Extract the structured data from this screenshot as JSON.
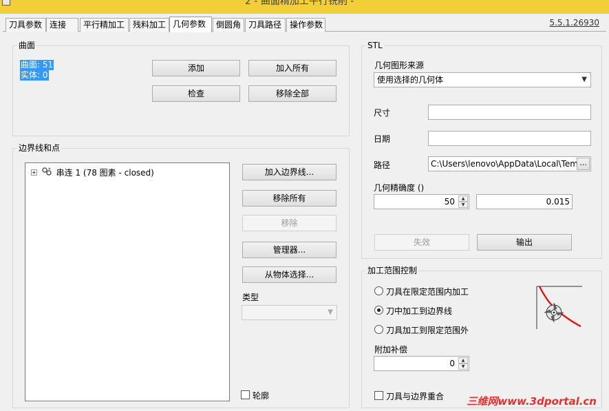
{
  "window": {
    "title": "2 - 曲面精加工平行铣削 -"
  },
  "tabs": [
    {
      "label": "刀具参数"
    },
    {
      "label": "连接"
    },
    {
      "label": "平行精加工"
    },
    {
      "label": "残料加工"
    },
    {
      "label": "几何参数",
      "active": true
    },
    {
      "label": "倒圆角"
    },
    {
      "label": "刀具路径"
    },
    {
      "label": "操作参数"
    }
  ],
  "version": "5.5.1.26930",
  "surfaces": {
    "group_label": "曲面",
    "list": [
      "曲面: 51",
      "实体: 0"
    ],
    "add_label": "添加",
    "add_all_label": "加入所有",
    "check_label": "检查",
    "remove_all_label": "移除全部"
  },
  "boundaries": {
    "group_label": "边界线和点",
    "tree_item": "串连 1 (78 图素 - closed)",
    "add_boundary_label": "加入边界线...",
    "remove_all_label": "移除所有",
    "remove_label": "移除",
    "manager_label": "管理器...",
    "select_from_object_label": "从物体选择...",
    "type_label": "类型",
    "type_value": "",
    "contour_label": "轮廓"
  },
  "stl": {
    "group_label": "STL",
    "source_label": "几何图形来源",
    "source_value": "使用选择的几何体",
    "size_label": "尺寸",
    "size_value": "",
    "date_label": "日期",
    "date_value": "",
    "path_label": "路径",
    "path_value": "C:\\Users\\lenovo\\AppData\\Local\\Tem",
    "browse_label": "...",
    "accuracy_label": "几何精确度 ()",
    "accuracy_int": "50",
    "accuracy_value": "0.015",
    "disable_label": "失效",
    "export_label": "输出"
  },
  "machining_range": {
    "group_label": "加工范围控制",
    "options": [
      {
        "label": "刀具在限定范围内加工",
        "checked": false
      },
      {
        "label": "刀中加工到边界线",
        "checked": true
      },
      {
        "label": "刀具加工到限定范围外",
        "checked": false
      }
    ],
    "offset_label": "附加补偿",
    "offset_value": "0",
    "coincide_label": "刀具与边界重合"
  },
  "colors": {
    "title_bar": "#f2ce38",
    "selection": "#3399ff",
    "boundary_curve": "#e01818"
  },
  "watermark": "三维网www.3dportal.cn"
}
